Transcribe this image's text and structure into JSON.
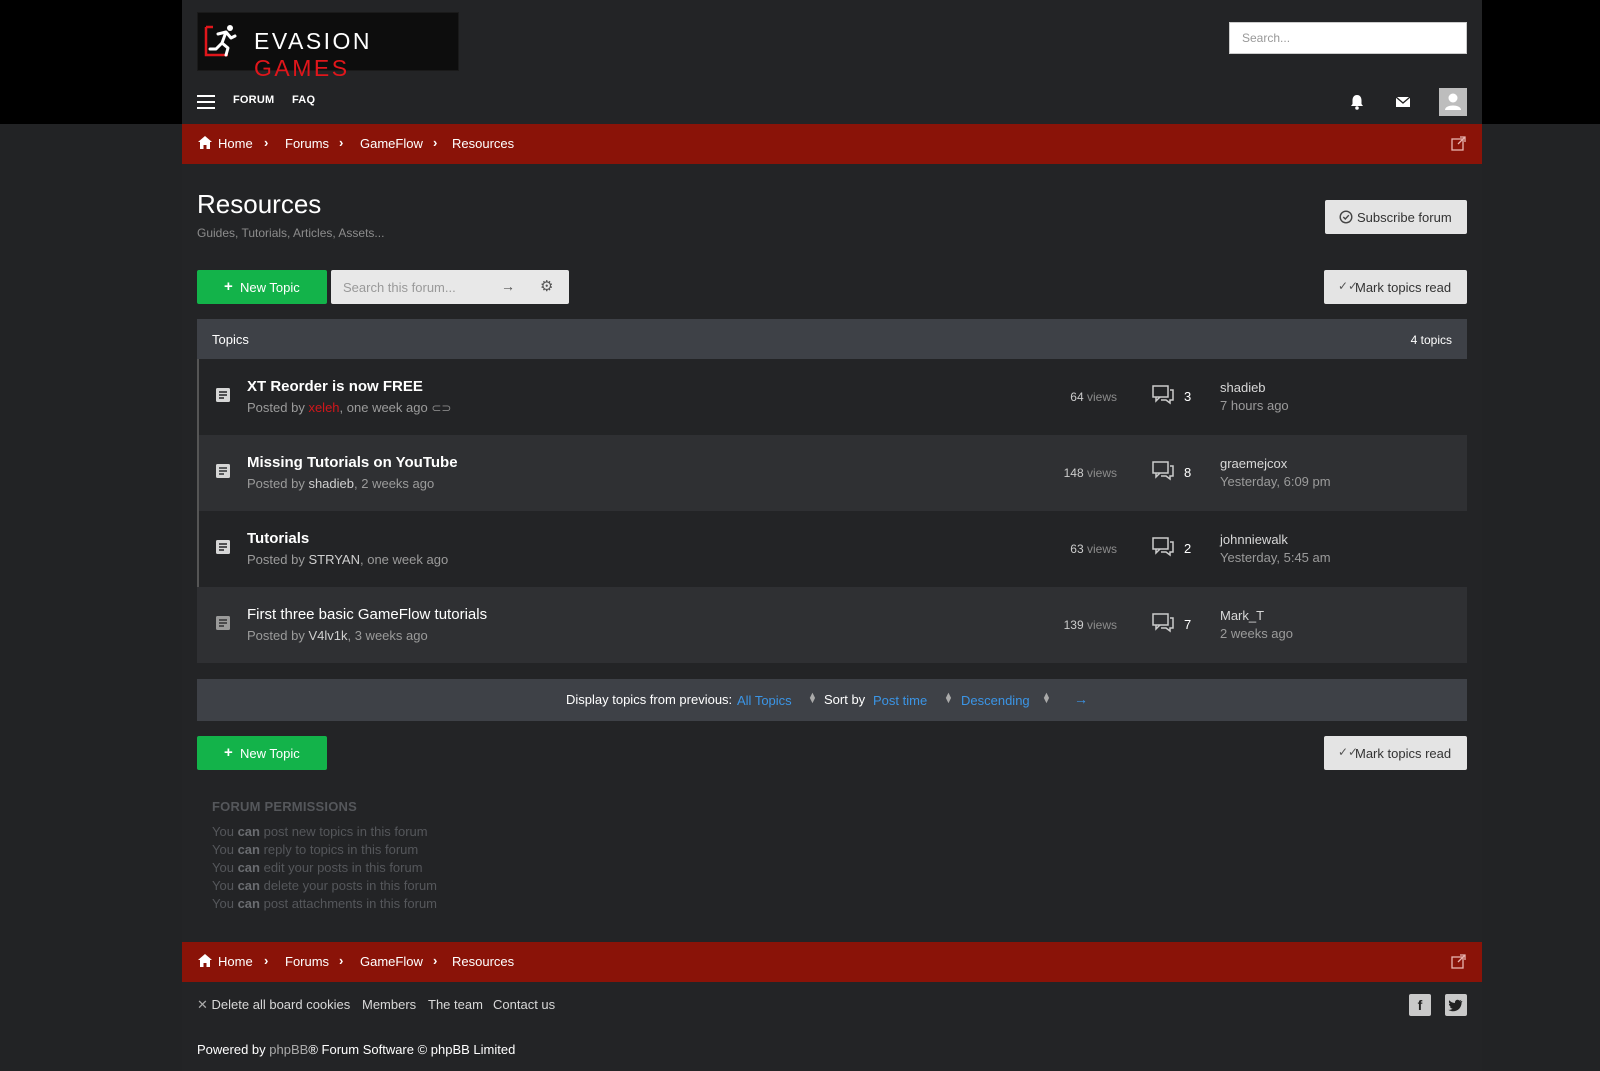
{
  "header": {
    "logo_text_main": "EVASION",
    "logo_text_accent": "GAMES",
    "search_placeholder": "Search...",
    "nav": [
      {
        "label": "FORUM"
      },
      {
        "label": "FAQ"
      }
    ]
  },
  "breadcrumb": {
    "items": [
      "Home",
      "Forums",
      "GameFlow",
      "Resources"
    ]
  },
  "page": {
    "title": "Resources",
    "description": "Guides, Tutorials, Articles, Assets...",
    "subscribe_label": "Subscribe forum",
    "new_topic_label": "New Topic",
    "search_placeholder": "Search this forum...",
    "mark_read_label": "Mark topics read"
  },
  "topics": {
    "header_label": "Topics",
    "count_label": "4 topics",
    "posted_by": "Posted by",
    "views_unit": "views",
    "rows": [
      {
        "title": "XT Reorder is now FREE",
        "author": "xeleh",
        "age": "one week ago",
        "views": "64",
        "replies": "3",
        "last_user": "shadieb",
        "last_time": "7 hours ago"
      },
      {
        "title": "Missing Tutorials on YouTube",
        "author": "shadieb",
        "age": "2 weeks ago",
        "views": "148",
        "replies": "8",
        "last_user": "graemejcox",
        "last_time": "Yesterday, 6:09 pm"
      },
      {
        "title": "Tutorials",
        "author": "STRYAN",
        "age": "one week ago",
        "views": "63",
        "replies": "2",
        "last_user": "johnniewalk",
        "last_time": "Yesterday, 5:45 am"
      },
      {
        "title": "First three basic GameFlow tutorials",
        "author": "V4lv1k",
        "age": "3 weeks ago",
        "views": "139",
        "replies": "7",
        "last_user": "Mark_T",
        "last_time": "2 weeks ago"
      }
    ]
  },
  "sort": {
    "display_label": "Display topics from previous:",
    "display_value": "All Topics",
    "sort_label": "Sort by",
    "sort_value": "Post time",
    "order_value": "Descending"
  },
  "permissions": {
    "title": "FORUM PERMISSIONS",
    "you": "You",
    "can": "can",
    "lines": [
      "post new topics in this forum",
      "reply to topics in this forum",
      "edit your posts in this forum",
      "delete your posts in this forum",
      "post attachments in this forum"
    ]
  },
  "footer": {
    "delete_cookies": "Delete all board cookies",
    "members": "Members",
    "team": "The team",
    "contact": "Contact us",
    "powered_prefix": "Powered by",
    "powered_phpbb": "phpBB",
    "powered_suffix": "® Forum Software © phpBB Limited"
  },
  "colors": {
    "brand_red": "#8a1308",
    "accent_green": "#13b34a",
    "link_blue": "#3b95e6"
  }
}
